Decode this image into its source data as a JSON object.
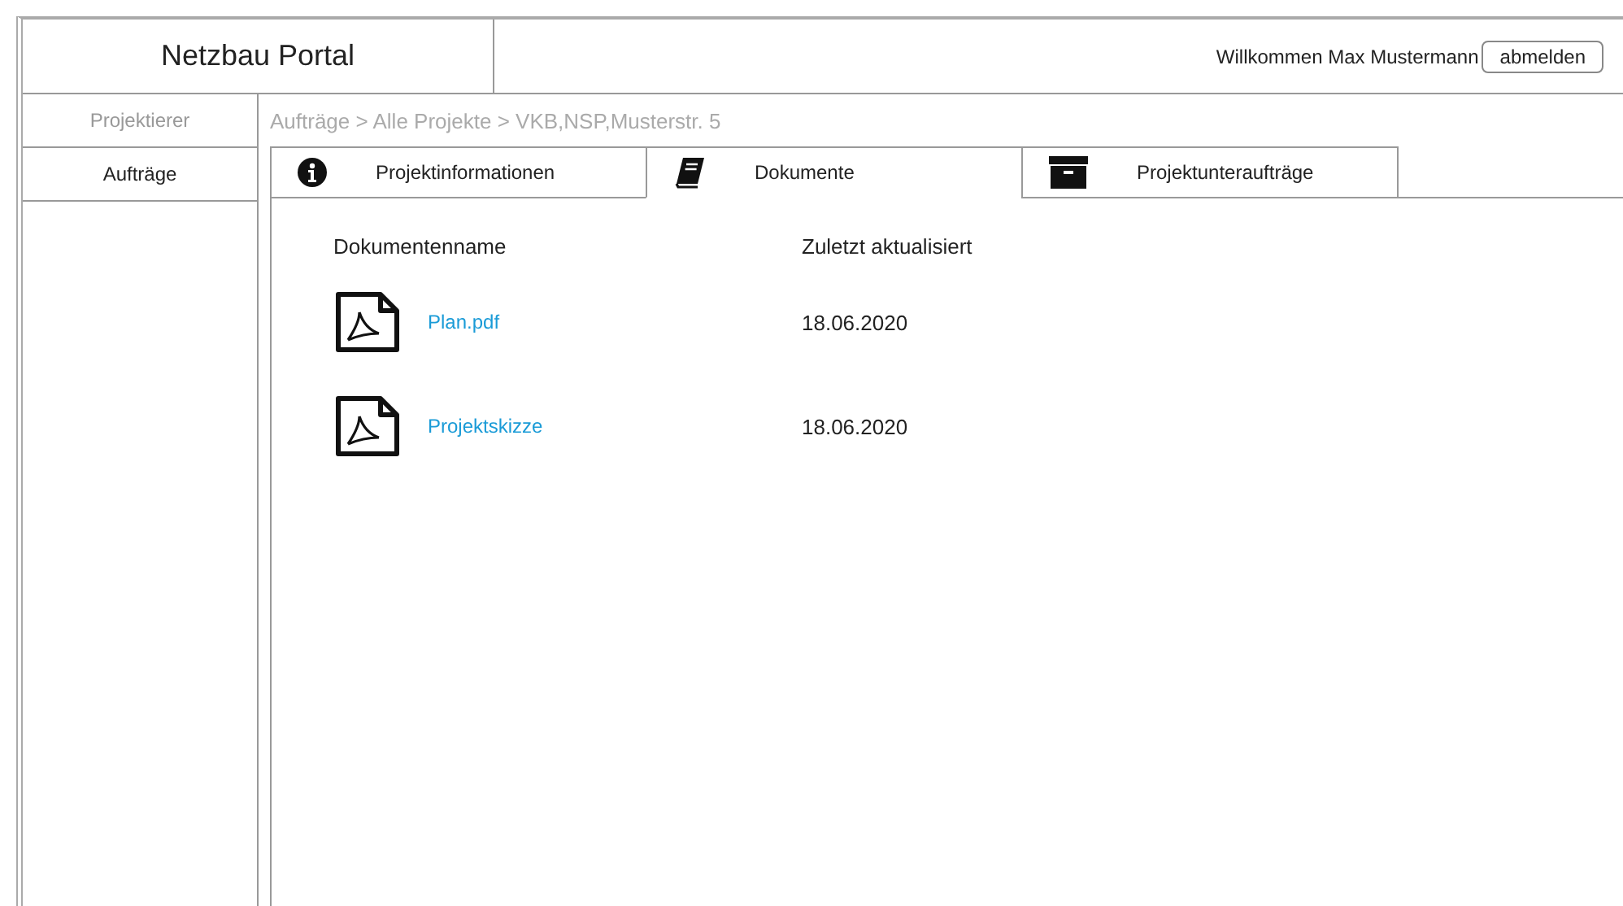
{
  "header": {
    "title": "Netzbau Portal",
    "welcome": "Willkommen Max Mustermann",
    "logout_button": "abmelden"
  },
  "sidebar": {
    "items": [
      {
        "label": "Projektierer",
        "selected": false
      },
      {
        "label": "Aufträge",
        "selected": true
      }
    ]
  },
  "breadcrumb": "Aufträge > Alle Projekte > VKB,NSP,Musterstr. 5",
  "tabs": [
    {
      "label": "Projektinformationen",
      "kind": "info",
      "selected": false
    },
    {
      "label": "Dokumente",
      "kind": "book",
      "selected": true
    },
    {
      "label": "Projektunteraufträge",
      "kind": "archive",
      "selected": false
    }
  ],
  "table": {
    "columns": [
      "Dokumentenname",
      "Zuletzt aktualisiert"
    ],
    "rows": [
      {
        "name": "Plan.pdf",
        "date": "18.06.2020"
      },
      {
        "name": "Projektskizze",
        "date": "18.06.2020"
      }
    ]
  }
}
